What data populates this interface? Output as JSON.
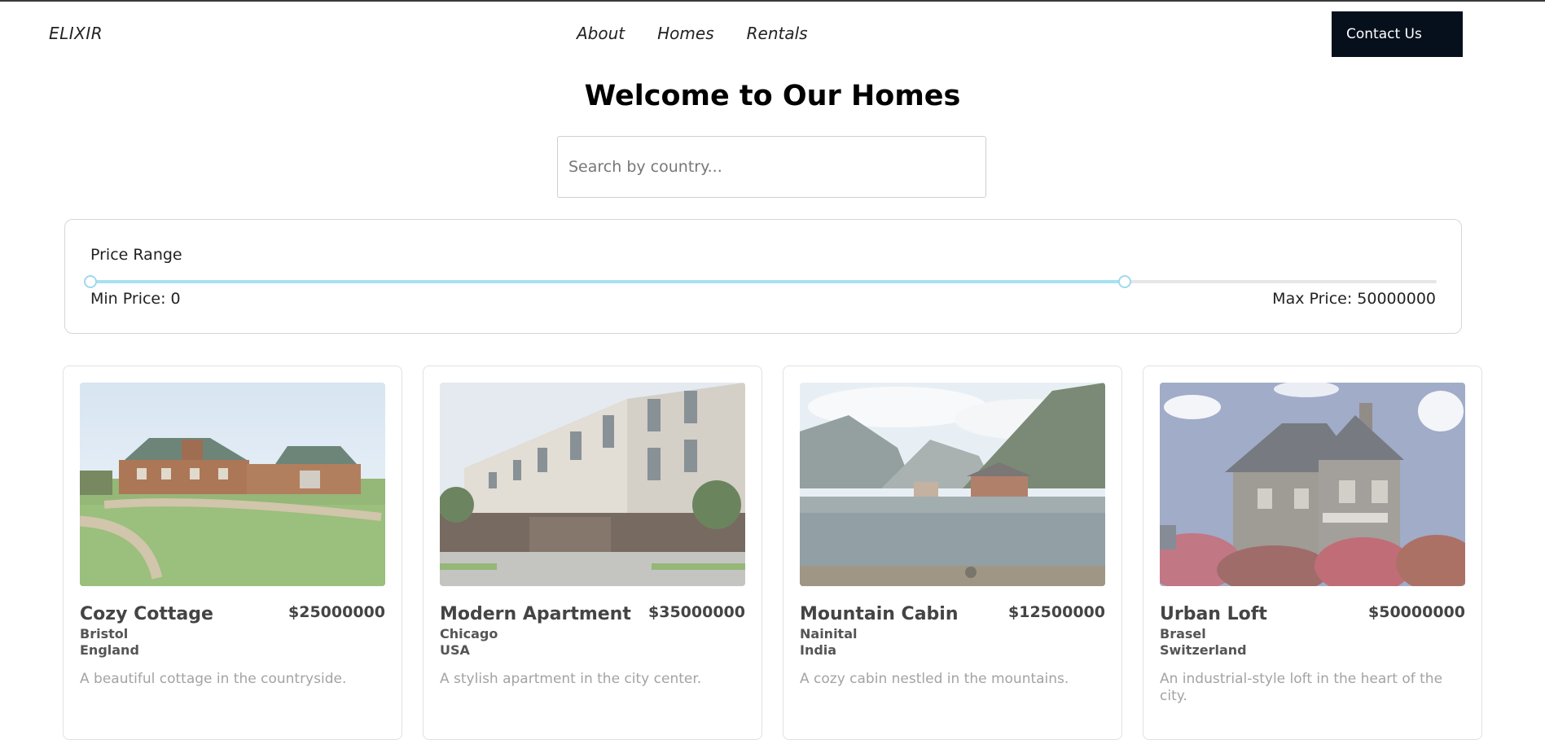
{
  "header": {
    "logo": "ELIXIR",
    "nav": [
      "About",
      "Homes",
      "Rentals"
    ],
    "contact_label": "Contact Us"
  },
  "main": {
    "title": "Welcome to Our Homes",
    "search": {
      "placeholder": "Search by country...",
      "value": ""
    }
  },
  "price_filter": {
    "label": "Price Range",
    "min_label": "Min Price: 0",
    "max_label": "Max Price: 50000000",
    "range_min": 0,
    "range_max": 50000000,
    "selected_max_fraction": 0.768
  },
  "colors": {
    "accent": "#a7e1f2",
    "button_bg": "#06101c"
  },
  "homes": [
    {
      "name": "Cozy Cottage",
      "price": "$25000000",
      "city": "Bristol",
      "country": "England",
      "description": "A beautiful cottage in the countryside.",
      "image": "log-house-on-lawn"
    },
    {
      "name": "Modern Apartment",
      "price": "$35000000",
      "city": "Chicago",
      "country": "USA",
      "description": "A stylish apartment in the city center.",
      "image": "townhouse-row"
    },
    {
      "name": "Mountain Cabin",
      "price": "$12500000",
      "city": "Nainital",
      "country": "India",
      "description": "A cozy cabin nestled in the mountains.",
      "image": "lakeside-mountain-cabin"
    },
    {
      "name": "Urban Loft",
      "price": "$50000000",
      "city": "Brasel",
      "country": "Switzerland",
      "description": "An industrial-style loft in the heart of the city.",
      "image": "stone-mansion"
    }
  ]
}
